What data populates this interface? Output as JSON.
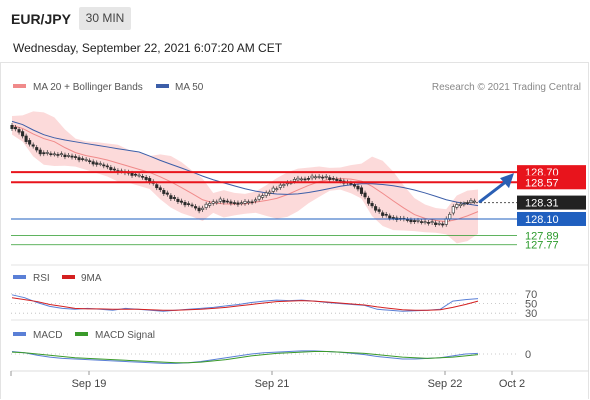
{
  "header": {
    "symbol": "EUR/JPY",
    "timeframe": "30 MIN",
    "datetime": "Wednesday, September 22, 2021 6:07:20 AM CET"
  },
  "colors": {
    "ma20": "#f08a8a",
    "bollinger_fill": "#fbd3d3",
    "ma50": "#3c5ea8",
    "resistance": "#e8141c",
    "support_blue": "#1f5fbf",
    "support_green": "#2a9a2a",
    "candle_up": "#c8202a",
    "candle_down": "#2a6a2a",
    "arrow": "#2a5fb4",
    "rsi": "#5a7fd6",
    "rsi_ma": "#d42020",
    "macd": "#5a7fd6",
    "macd_signal": "#3a9a2a",
    "last_price_bg": "#222222"
  },
  "chart_data": [
    {
      "type": "candlestick",
      "panel": "price",
      "legend": [
        {
          "name": "MA 20 + Bollinger Bands",
          "color": "#f08a8a"
        },
        {
          "name": "MA 50",
          "color": "#3c5ea8"
        }
      ],
      "credit": "Research © 2021 Trading Central",
      "ylim": [
        127.6,
        129.65
      ],
      "x_ticks": [
        "Sep 19",
        "Sep 21",
        "Sep 22",
        "Oct 2"
      ],
      "close_series": [
        129.3,
        129.22,
        129.05,
        128.95,
        128.93,
        128.92,
        128.9,
        128.86,
        128.82,
        128.78,
        128.72,
        128.7,
        128.66,
        128.62,
        128.5,
        128.4,
        128.33,
        128.28,
        128.22,
        128.3,
        128.34,
        128.31,
        128.3,
        128.33,
        128.4,
        128.48,
        128.55,
        128.6,
        128.62,
        128.64,
        128.63,
        128.6,
        128.56,
        128.5,
        128.3,
        128.18,
        128.12,
        128.1,
        128.08,
        128.06,
        128.05,
        128.03,
        128.25,
        128.31,
        128.33
      ],
      "levels": [
        {
          "value": 128.7,
          "label": "128.70",
          "style": "resistance"
        },
        {
          "value": 128.57,
          "label": "128.57",
          "style": "resistance"
        },
        {
          "value": 128.31,
          "label": "128.31",
          "style": "last_price"
        },
        {
          "value": 128.1,
          "label": "128.10",
          "style": "support_blue"
        },
        {
          "value": 127.89,
          "label": "127.89",
          "style": "support_green"
        },
        {
          "value": 127.77,
          "label": "127.77",
          "style": "support_green"
        }
      ],
      "forecast_arrow": {
        "from": 128.31,
        "to": 128.7
      }
    },
    {
      "type": "line",
      "panel": "rsi",
      "legend": [
        {
          "name": "RSI",
          "color": "#5a7fd6"
        },
        {
          "name": "9MA",
          "color": "#d42020"
        }
      ],
      "y_ticks": [
        "70",
        "50",
        "30"
      ],
      "ylim": [
        20,
        80
      ],
      "series": [
        {
          "name": "RSI",
          "values": [
            68,
            62,
            52,
            44,
            40,
            38,
            40,
            38,
            36,
            40,
            38,
            36,
            34,
            36,
            38,
            40,
            42,
            45,
            48,
            52,
            55,
            57,
            56,
            57,
            55,
            52,
            50,
            48,
            46,
            38,
            36,
            34,
            35,
            36,
            38,
            55,
            58,
            60
          ]
        },
        {
          "name": "9MA",
          "values": [
            62,
            58,
            54,
            48,
            44,
            40,
            39,
            39,
            38,
            38,
            38,
            37,
            36,
            36,
            37,
            38,
            40,
            42,
            45,
            48,
            51,
            54,
            55,
            56,
            55,
            53,
            51,
            49,
            47,
            43,
            40,
            37,
            36,
            36,
            37,
            42,
            48,
            55
          ]
        }
      ]
    },
    {
      "type": "line",
      "panel": "macd",
      "legend": [
        {
          "name": "MACD",
          "color": "#5a7fd6"
        },
        {
          "name": "MACD Signal",
          "color": "#3a9a2a"
        }
      ],
      "y_ticks": [
        "0"
      ],
      "series": [
        {
          "name": "MACD",
          "values": [
            0.04,
            0.02,
            -0.02,
            -0.05,
            -0.07,
            -0.08,
            -0.09,
            -0.1,
            -0.11,
            -0.12,
            -0.13,
            -0.14,
            -0.15,
            -0.15,
            -0.14,
            -0.12,
            -0.09,
            -0.06,
            -0.03,
            0.0,
            0.02,
            0.03,
            0.04,
            0.05,
            0.05,
            0.04,
            0.03,
            0.01,
            -0.01,
            -0.04,
            -0.06,
            -0.08,
            -0.08,
            -0.07,
            -0.06,
            -0.03,
            0.0,
            0.01
          ]
        },
        {
          "name": "MACD Signal",
          "values": [
            0.03,
            0.02,
            0.0,
            -0.02,
            -0.04,
            -0.06,
            -0.07,
            -0.08,
            -0.09,
            -0.1,
            -0.11,
            -0.12,
            -0.13,
            -0.14,
            -0.14,
            -0.13,
            -0.11,
            -0.09,
            -0.06,
            -0.03,
            -0.01,
            0.01,
            0.02,
            0.03,
            0.04,
            0.04,
            0.03,
            0.02,
            0.01,
            -0.01,
            -0.03,
            -0.05,
            -0.06,
            -0.07,
            -0.06,
            -0.05,
            -0.03,
            -0.01
          ]
        }
      ]
    }
  ]
}
